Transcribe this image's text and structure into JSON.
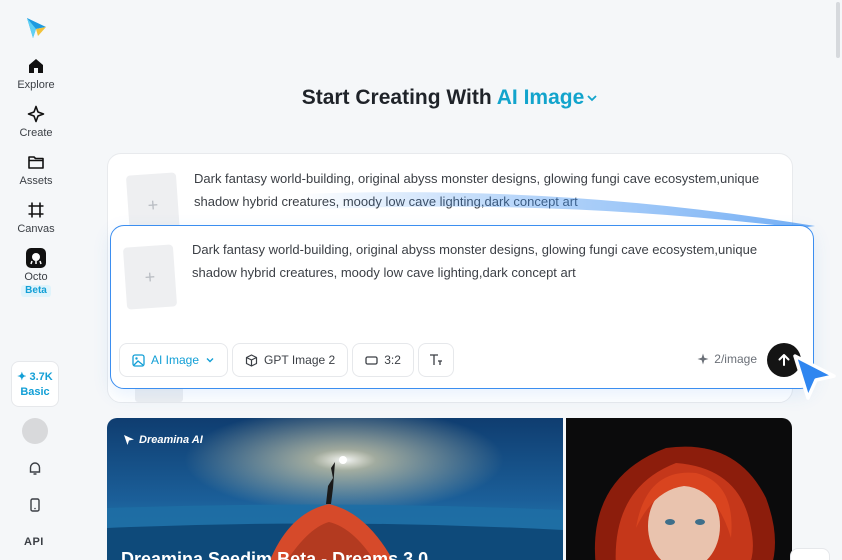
{
  "sidebar": {
    "items": [
      {
        "label": "Explore",
        "icon": "home-icon"
      },
      {
        "label": "Create",
        "icon": "sparkle-icon"
      },
      {
        "label": "Assets",
        "icon": "folder-icon"
      },
      {
        "label": "Canvas",
        "icon": "canvas-icon"
      },
      {
        "label": "Octo",
        "icon": "octo-icon"
      }
    ],
    "beta_badge": "Beta",
    "credits_amount": "✦ 3.7K",
    "credits_plan": "Basic",
    "api_label": "API"
  },
  "header": {
    "title_prefix": "Start Creating With",
    "title_accent": "AI Image"
  },
  "prompt_back": {
    "text": "Dark fantasy world-building, original abyss monster designs, glowing fungi cave ecosystem,unique shadow hybrid creatures, moody low cave lighting,dark concept art",
    "add_glyph": "+"
  },
  "prompt_front": {
    "text": "Dark fantasy world-building, original abyss monster designs, glowing fungi cave ecosystem,unique shadow hybrid creatures, moody low cave lighting,dark concept art",
    "add_glyph": "+",
    "toolbar": {
      "mode_label": "AI Image",
      "model_label": "GPT Image 2",
      "ratio_label": "3:2"
    },
    "cost_label": "2/image"
  },
  "banner": {
    "brand": "Dreamina AI",
    "title": "Dreamina Seedim Beta - Dreams 3.0"
  },
  "colors": {
    "accent": "#12a4cc",
    "focus_border": "#3b8ef0",
    "send_button": "#141414"
  }
}
